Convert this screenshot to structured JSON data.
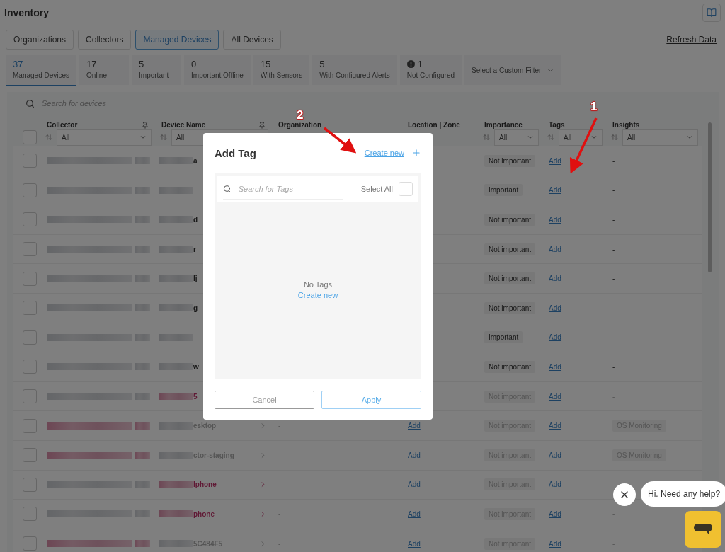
{
  "page": {
    "title": "Inventory"
  },
  "tabs": [
    {
      "label": "Organizations",
      "selected": false
    },
    {
      "label": "Collectors",
      "selected": false
    },
    {
      "label": "Managed Devices",
      "selected": true
    },
    {
      "label": "All Devices",
      "selected": false
    }
  ],
  "refresh_link": "Refresh Data",
  "stats": [
    {
      "value": "37",
      "label": "Managed Devices",
      "selected": true,
      "kind": "plain"
    },
    {
      "value": "17",
      "label": "Online",
      "selected": false,
      "kind": "plain"
    },
    {
      "value": "5",
      "label": "Important",
      "selected": false,
      "kind": "plain"
    },
    {
      "value": "0",
      "label": "Important Offline",
      "selected": false,
      "kind": "plain"
    },
    {
      "value": "15",
      "label": "With Sensors",
      "selected": false,
      "kind": "plain"
    },
    {
      "value": "5",
      "label": "With Configured Alerts",
      "selected": false,
      "kind": "plain"
    },
    {
      "value": "1",
      "label": "Not Configured",
      "selected": false,
      "kind": "warning"
    }
  ],
  "custom_filter": {
    "placeholder": "Select a Custom Filter"
  },
  "search": {
    "placeholder": "Search for devices"
  },
  "table": {
    "select_all_checked": false,
    "columns": [
      {
        "label": "Collector",
        "pinned": true,
        "filter": "All"
      },
      {
        "label": "Device Name",
        "pinned": true,
        "filter": "All"
      },
      {
        "label": "Organization",
        "pinned": false
      },
      {
        "label": "Location | Zone",
        "pinned": false
      },
      {
        "label": "Importance",
        "pinned": false,
        "filter": "All"
      },
      {
        "label": "Tags",
        "pinned": false,
        "filter": "All"
      },
      {
        "label": "Insights",
        "pinned": false,
        "filter": "All"
      }
    ],
    "rows": [
      {
        "checked": false,
        "dimmed": false,
        "collector_alert": false,
        "device_alert": false,
        "device_name": "a",
        "importance": "Not important",
        "tags": "Add",
        "insights": "-"
      },
      {
        "checked": false,
        "dimmed": false,
        "collector_alert": false,
        "device_alert": false,
        "device_name": "",
        "importance": "Important",
        "tags": "Add",
        "insights": "-"
      },
      {
        "checked": false,
        "dimmed": false,
        "collector_alert": false,
        "device_alert": false,
        "device_name": "d",
        "importance": "Not important",
        "tags": "Add",
        "insights": "-"
      },
      {
        "checked": false,
        "dimmed": false,
        "collector_alert": false,
        "device_alert": false,
        "device_name": "r",
        "importance": "Not important",
        "tags": "Add",
        "insights": "-"
      },
      {
        "checked": false,
        "dimmed": false,
        "collector_alert": false,
        "device_alert": false,
        "device_name": "lj",
        "importance": "Not important",
        "tags": "Add",
        "insights": "-"
      },
      {
        "checked": false,
        "dimmed": false,
        "collector_alert": false,
        "device_alert": false,
        "device_name": "g",
        "importance": "Not important",
        "tags": "Add",
        "insights": "-"
      },
      {
        "checked": false,
        "dimmed": false,
        "collector_alert": false,
        "device_alert": false,
        "device_name": "",
        "importance": "Important",
        "tags": "Add",
        "insights": "-"
      },
      {
        "checked": false,
        "dimmed": false,
        "collector_alert": false,
        "device_alert": false,
        "device_name": "w",
        "importance": "Not important",
        "tags": "Add",
        "insights": "-"
      },
      {
        "checked": false,
        "dimmed": true,
        "collector_alert": false,
        "device_alert": true,
        "device_name": "5",
        "importance": "Not important",
        "tags": "Add",
        "insights": "-"
      },
      {
        "checked": false,
        "dimmed": true,
        "collector_alert": true,
        "device_alert": false,
        "device_name": "esktop",
        "organization": "-",
        "location": "Add",
        "importance": "Not important",
        "tags": "Add",
        "insights": "OS Monitoring"
      },
      {
        "checked": false,
        "dimmed": true,
        "collector_alert": true,
        "device_alert": false,
        "device_name": "ctor-staging",
        "organization": "-",
        "location": "Add",
        "importance": "Not important",
        "tags": "Add",
        "insights": "OS Monitoring"
      },
      {
        "checked": false,
        "dimmed": true,
        "collector_alert": false,
        "device_alert": true,
        "device_name": "lphone",
        "organization": "-",
        "location": "Add",
        "importance": "Not important",
        "tags": "Add",
        "insights": "-"
      },
      {
        "checked": false,
        "dimmed": true,
        "collector_alert": false,
        "device_alert": true,
        "device_name": "phone",
        "organization": "-",
        "location": "Add",
        "importance": "Not important",
        "tags": "Add",
        "insights": "-"
      },
      {
        "checked": false,
        "dimmed": true,
        "collector_alert": true,
        "device_alert": false,
        "device_name": "5C484F5",
        "organization": "-",
        "location": "Add",
        "importance": "Not important",
        "tags": "Add",
        "insights": "-"
      }
    ]
  },
  "modal": {
    "title": "Add Tag",
    "create_link": "Create new",
    "search_placeholder": "Search for Tags",
    "select_all": {
      "label": "Select All",
      "checked": false
    },
    "empty_text": "No Tags",
    "empty_link": "Create new",
    "buttons": [
      {
        "label": "Cancel",
        "kind": "secondary"
      },
      {
        "label": "Apply",
        "kind": "primary"
      }
    ]
  },
  "annotations": [
    {
      "label": "1"
    },
    {
      "label": "2"
    }
  ],
  "chat": {
    "greeting": "Hi. Need any help?"
  }
}
